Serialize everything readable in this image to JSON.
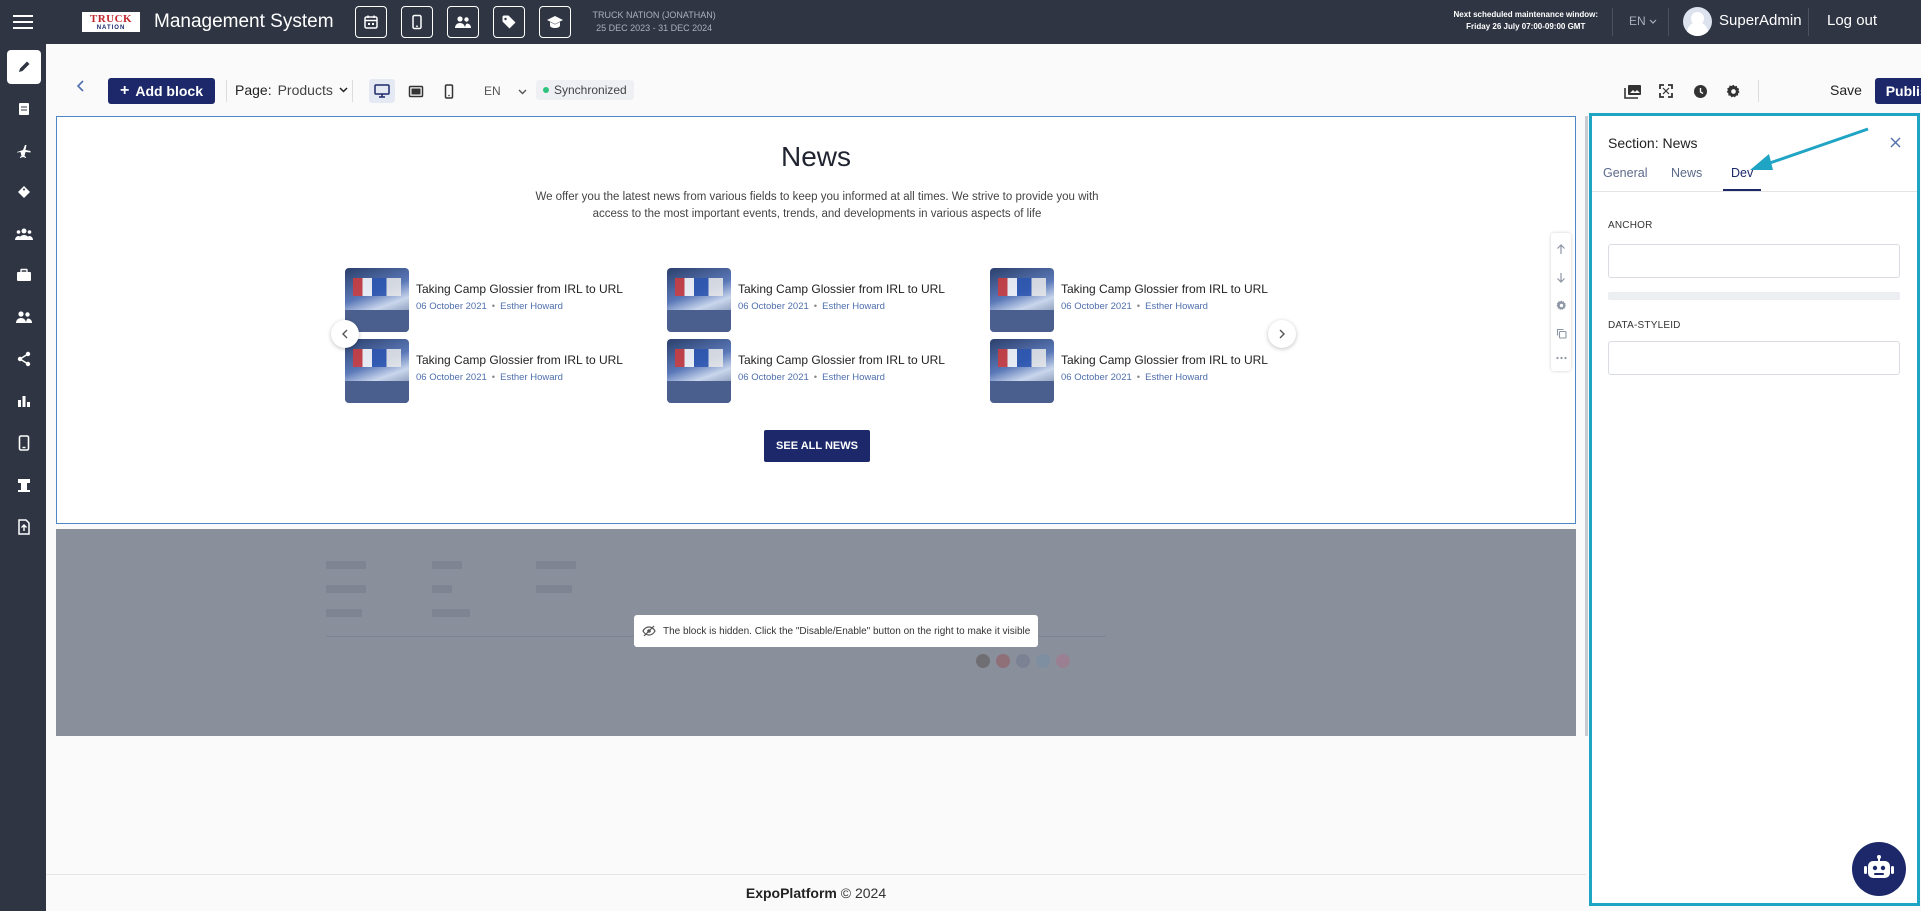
{
  "topbar": {
    "logo_line1": "TRUCK",
    "logo_line2": "NATION",
    "app_title": "Management System",
    "event_name": "TRUCK NATION (JONATHAN)",
    "event_dates": "25 DEC 2023 - 31 DEC 2024",
    "maintenance_line1": "Next scheduled maintenance window:",
    "maintenance_line2": "Friday 26 July 07:00-09:00 GMT",
    "language": "EN",
    "user_name": "SuperAdmin",
    "logout_label": "Log out",
    "shortcut_icons": [
      "calendar-icon",
      "mobile-icon",
      "people-icon",
      "tag-icon",
      "graduation-cap-icon"
    ]
  },
  "sidebar": {
    "items": [
      "pencil-icon",
      "document-icon",
      "plane-icon",
      "tag-icon",
      "group-icon",
      "briefcase-icon",
      "users-icon",
      "share-icon",
      "bar-chart-icon",
      "mobile-icon",
      "stand-icon",
      "file-export-icon"
    ]
  },
  "toolbar": {
    "add_block_label": "Add block",
    "page_label": "Page:",
    "page_value": "Products",
    "language": "EN",
    "sync_status": "Synchronized",
    "save_label": "Save",
    "publish_label": "Publish"
  },
  "news": {
    "title": "News",
    "subtitle": "We offer you the latest news from various fields to keep you informed at all times. We strive to provide you with access to the most important events, trends, and developments in various aspects of life",
    "items": [
      {
        "headline": "Taking Camp Glossier from IRL to URL",
        "date": "06 October 2021",
        "author": "Esther Howard"
      },
      {
        "headline": "Taking Camp Glossier from IRL to URL",
        "date": "06 October 2021",
        "author": "Esther Howard"
      },
      {
        "headline": "Taking Camp Glossier from IRL to URL",
        "date": "06 October 2021",
        "author": "Esther Howard"
      },
      {
        "headline": "Taking Camp Glossier from IRL to URL",
        "date": "06 October 2021",
        "author": "Esther Howard"
      },
      {
        "headline": "Taking Camp Glossier from IRL to URL",
        "date": "06 October 2021",
        "author": "Esther Howard"
      },
      {
        "headline": "Taking Camp Glossier from IRL to URL",
        "date": "06 October 2021",
        "author": "Esther Howard"
      }
    ],
    "see_all_label": "SEE ALL NEWS"
  },
  "hidden_block": {
    "message": "The block is hidden. Click the \"Disable/Enable\" button on the right to make it visible"
  },
  "footer": {
    "brand": "ExpoPlatform",
    "copyright": "© 2024"
  },
  "panel": {
    "title": "Section: News",
    "tabs": [
      "General",
      "News",
      "Dev"
    ],
    "active_tab": "Dev",
    "anchor_label": "ANCHOR",
    "anchor_value": "",
    "styleid_label": "DATA-STYLEID",
    "styleid_value": ""
  },
  "colors": {
    "dark_bar": "#2f3542",
    "primary": "#1c2869",
    "highlight": "#20a4c4",
    "sync_dot": "#2ec27e"
  }
}
